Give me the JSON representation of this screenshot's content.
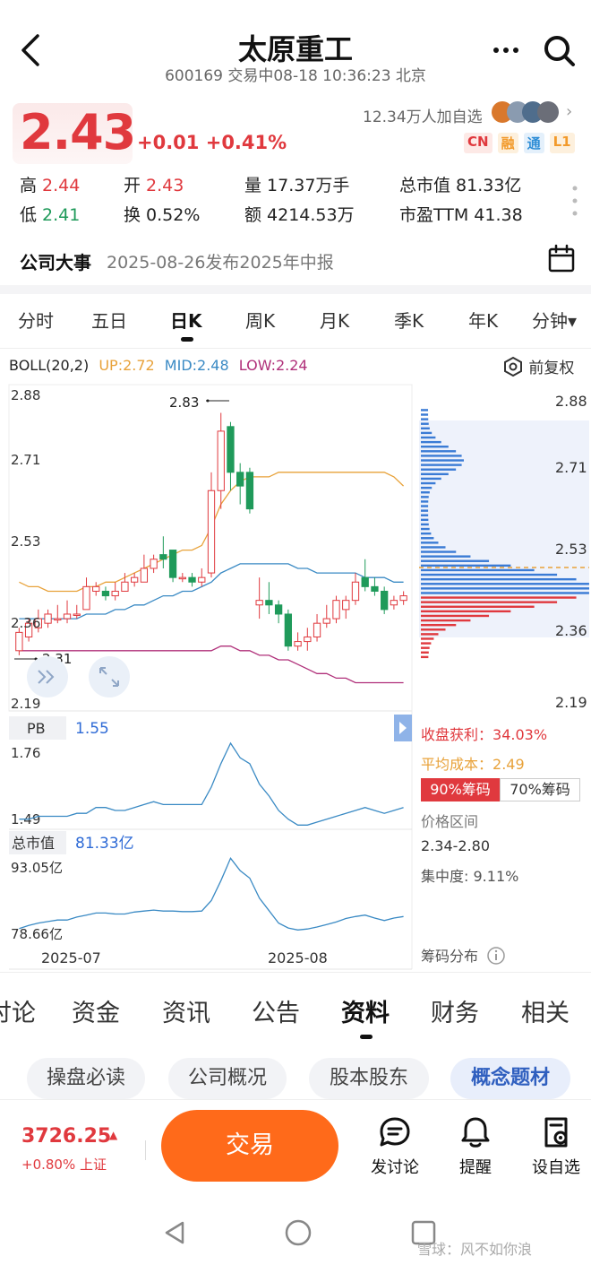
{
  "header": {
    "title": "太原重工",
    "subtitle": "600169 交易中08-18 10:36:23 北京"
  },
  "quote": {
    "price": "2.43",
    "change": "+0.01 +0.41%",
    "followers": "12.34万人加自选",
    "tags": [
      "CN",
      "融",
      "通",
      "L1"
    ],
    "high_label": "高",
    "high": "2.44",
    "open_label": "开",
    "open": "2.43",
    "volume_label": "量",
    "volume": "17.37万手",
    "mktcap_label": "总市值",
    "mktcap": "81.33亿",
    "low_label": "低",
    "low": "2.41",
    "turnover_label": "换",
    "turnover": "0.52%",
    "amount_label": "额",
    "amount": "4214.53万",
    "pe_label": "市盈TTM",
    "pe": "41.38"
  },
  "event": {
    "label": "公司大事",
    "text": "2025-08-26发布2025年中报"
  },
  "period_tabs": [
    "分时",
    "五日",
    "日K",
    "周K",
    "月K",
    "季K",
    "年K",
    "分钟▾"
  ],
  "active_period": "日K",
  "boll": {
    "name": "BOLL(20,2)",
    "up": "UP:2.72",
    "mid": "MID:2.48",
    "low": "LOW:2.24",
    "fq_label": "前复权",
    "colors": {
      "up": "#e8a23a",
      "mid": "#3a8ac4",
      "low": "#b0307a"
    }
  },
  "main_chart": {
    "left_ticks": [
      "2.88",
      "2.71",
      "2.53",
      "2.36",
      "2.19"
    ],
    "right_ticks": [
      "2.88",
      "2.71",
      "2.53",
      "2.36",
      "2.19"
    ],
    "max_label": "2.83",
    "min_label": "2.31"
  },
  "chart_data": {
    "type": "candlestick",
    "ylim": [
      2.19,
      2.88
    ],
    "x_labels": [
      "2025-07",
      "2025-08"
    ],
    "candles": [
      {
        "o": 2.31,
        "c": 2.35,
        "h": 2.36,
        "l": 2.3
      },
      {
        "o": 2.34,
        "c": 2.37,
        "h": 2.38,
        "l": 2.33
      },
      {
        "o": 2.36,
        "c": 2.38,
        "h": 2.4,
        "l": 2.35
      },
      {
        "o": 2.37,
        "c": 2.39,
        "h": 2.4,
        "l": 2.36
      },
      {
        "o": 2.38,
        "c": 2.38,
        "h": 2.41,
        "l": 2.37
      },
      {
        "o": 2.38,
        "c": 2.39,
        "h": 2.42,
        "l": 2.37
      },
      {
        "o": 2.39,
        "c": 2.39,
        "h": 2.41,
        "l": 2.38
      },
      {
        "o": 2.4,
        "c": 2.45,
        "h": 2.47,
        "l": 2.4
      },
      {
        "o": 2.44,
        "c": 2.45,
        "h": 2.46,
        "l": 2.43
      },
      {
        "o": 2.44,
        "c": 2.43,
        "h": 2.45,
        "l": 2.42
      },
      {
        "o": 2.43,
        "c": 2.44,
        "h": 2.46,
        "l": 2.42
      },
      {
        "o": 2.44,
        "c": 2.46,
        "h": 2.48,
        "l": 2.44
      },
      {
        "o": 2.46,
        "c": 2.47,
        "h": 2.48,
        "l": 2.45
      },
      {
        "o": 2.46,
        "c": 2.49,
        "h": 2.52,
        "l": 2.46
      },
      {
        "o": 2.49,
        "c": 2.51,
        "h": 2.52,
        "l": 2.48
      },
      {
        "o": 2.52,
        "c": 2.51,
        "h": 2.56,
        "l": 2.49
      },
      {
        "o": 2.53,
        "c": 2.47,
        "h": 2.53,
        "l": 2.46
      },
      {
        "o": 2.47,
        "c": 2.47,
        "h": 2.48,
        "l": 2.46
      },
      {
        "o": 2.47,
        "c": 2.46,
        "h": 2.48,
        "l": 2.45
      },
      {
        "o": 2.46,
        "c": 2.47,
        "h": 2.49,
        "l": 2.45
      },
      {
        "o": 2.48,
        "c": 2.66,
        "h": 2.7,
        "l": 2.47
      },
      {
        "o": 2.66,
        "c": 2.79,
        "h": 2.83,
        "l": 2.62
      },
      {
        "o": 2.8,
        "c": 2.7,
        "h": 2.81,
        "l": 2.66
      },
      {
        "o": 2.7,
        "c": 2.67,
        "h": 2.72,
        "l": 2.63
      },
      {
        "o": 2.7,
        "c": 2.62,
        "h": 2.71,
        "l": 2.61
      },
      {
        "o": 2.41,
        "c": 2.42,
        "h": 2.47,
        "l": 2.38
      },
      {
        "o": 2.42,
        "c": 2.41,
        "h": 2.46,
        "l": 2.39
      },
      {
        "o": 2.41,
        "c": 2.39,
        "h": 2.42,
        "l": 2.37
      },
      {
        "o": 2.39,
        "c": 2.32,
        "h": 2.4,
        "l": 2.31
      },
      {
        "o": 2.32,
        "c": 2.33,
        "h": 2.35,
        "l": 2.31
      },
      {
        "o": 2.33,
        "c": 2.34,
        "h": 2.36,
        "l": 2.31
      },
      {
        "o": 2.34,
        "c": 2.37,
        "h": 2.39,
        "l": 2.33
      },
      {
        "o": 2.37,
        "c": 2.38,
        "h": 2.41,
        "l": 2.36
      },
      {
        "o": 2.38,
        "c": 2.42,
        "h": 2.43,
        "l": 2.37
      },
      {
        "o": 2.4,
        "c": 2.42,
        "h": 2.43,
        "l": 2.38
      },
      {
        "o": 2.42,
        "c": 2.46,
        "h": 2.48,
        "l": 2.41
      },
      {
        "o": 2.47,
        "c": 2.45,
        "h": 2.51,
        "l": 2.44
      },
      {
        "o": 2.45,
        "c": 2.44,
        "h": 2.47,
        "l": 2.43
      },
      {
        "o": 2.44,
        "c": 2.4,
        "h": 2.45,
        "l": 2.39
      },
      {
        "o": 2.41,
        "c": 2.42,
        "h": 2.43,
        "l": 2.4
      },
      {
        "o": 2.42,
        "c": 2.43,
        "h": 2.44,
        "l": 2.41
      }
    ],
    "boll_up": [
      2.46,
      2.45,
      2.45,
      2.44,
      2.44,
      2.44,
      2.44,
      2.45,
      2.45,
      2.46,
      2.46,
      2.47,
      2.48,
      2.49,
      2.5,
      2.51,
      2.52,
      2.53,
      2.53,
      2.54,
      2.58,
      2.63,
      2.66,
      2.68,
      2.69,
      2.69,
      2.69,
      2.7,
      2.7,
      2.7,
      2.7,
      2.7,
      2.7,
      2.7,
      2.7,
      2.7,
      2.7,
      2.7,
      2.7,
      2.69,
      2.67
    ],
    "boll_mid": [
      2.38,
      2.38,
      2.38,
      2.38,
      2.38,
      2.38,
      2.38,
      2.39,
      2.39,
      2.39,
      2.4,
      2.4,
      2.41,
      2.41,
      2.42,
      2.43,
      2.43,
      2.44,
      2.44,
      2.45,
      2.46,
      2.48,
      2.49,
      2.5,
      2.5,
      2.5,
      2.5,
      2.5,
      2.5,
      2.49,
      2.49,
      2.48,
      2.48,
      2.48,
      2.48,
      2.48,
      2.47,
      2.47,
      2.47,
      2.46,
      2.46
    ],
    "boll_low": [
      2.31,
      2.31,
      2.31,
      2.31,
      2.31,
      2.31,
      2.31,
      2.31,
      2.31,
      2.31,
      2.31,
      2.31,
      2.31,
      2.31,
      2.31,
      2.31,
      2.31,
      2.31,
      2.31,
      2.31,
      2.31,
      2.32,
      2.32,
      2.31,
      2.31,
      2.3,
      2.3,
      2.29,
      2.29,
      2.28,
      2.27,
      2.26,
      2.26,
      2.25,
      2.25,
      2.24,
      2.24,
      2.24,
      2.24,
      2.24,
      2.24
    ]
  },
  "chips": {
    "profit_label": "收盘获利：",
    "profit": "34.03%",
    "avg_label": "平均成本：",
    "avg": "2.49",
    "btn90": "90%筹码",
    "btn70": "70%筹码",
    "range_label": "价格区间",
    "range": "2.34-2.80",
    "conc_label": "集中度:",
    "conc": "9.11%",
    "dist_label": "筹码分布",
    "profit_color": "#e0393e",
    "avg_color": "#e8a23a"
  },
  "pb": {
    "label": "PB",
    "value": "1.55",
    "top": "1.76",
    "bottom": "1.49",
    "series": [
      1.5,
      1.5,
      1.51,
      1.51,
      1.51,
      1.51,
      1.52,
      1.52,
      1.54,
      1.54,
      1.53,
      1.53,
      1.54,
      1.55,
      1.56,
      1.55,
      1.55,
      1.55,
      1.55,
      1.55,
      1.61,
      1.69,
      1.76,
      1.71,
      1.69,
      1.62,
      1.58,
      1.53,
      1.5,
      1.48,
      1.48,
      1.49,
      1.5,
      1.51,
      1.52,
      1.53,
      1.54,
      1.53,
      1.52,
      1.53,
      1.54
    ]
  },
  "mktcap_chart": {
    "label": "总市值",
    "value": "81.33亿",
    "top": "93.05亿",
    "bottom": "78.66亿",
    "series": [
      78.9,
      79.5,
      80.0,
      80.3,
      80.6,
      80.6,
      81.2,
      81.6,
      82.0,
      82.0,
      81.8,
      81.8,
      82.2,
      82.4,
      82.6,
      82.4,
      82.4,
      82.3,
      82.3,
      82.4,
      84.5,
      88.5,
      93.0,
      90.5,
      89.0,
      85.0,
      82.5,
      80.0,
      79.0,
      78.6,
      78.8,
      79.2,
      79.7,
      80.2,
      80.9,
      81.3,
      81.6,
      81.0,
      80.5,
      81.0,
      81.3
    ]
  },
  "bottom_tabs": [
    "讨论",
    "资金",
    "资讯",
    "公告",
    "资料",
    "财务",
    "相关"
  ],
  "active_bottom_tab": "资料",
  "sub_pills": [
    "操盘必读",
    "公司概况",
    "股本股东",
    "概念题材"
  ],
  "active_pill": "概念题材",
  "index": {
    "value": "3726.25",
    "change": "+0.80% 上证"
  },
  "trade_label": "交易",
  "actions": [
    "发讨论",
    "提醒",
    "设自选"
  ],
  "watermark": "雪球：风不如你浪"
}
